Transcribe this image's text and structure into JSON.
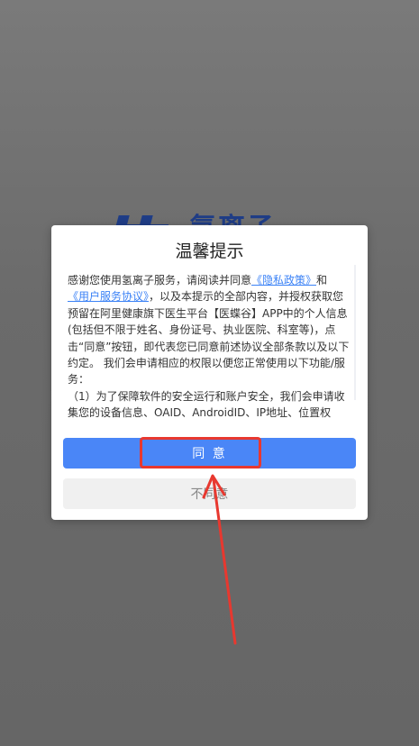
{
  "brand": {
    "logo_text": "氢离子"
  },
  "dialog": {
    "title": "温馨提示",
    "text_intro": "感谢您使用氢离子服务，请阅读并同意",
    "privacy_link": "《隐私政策》",
    "and_text": "和",
    "agreement_link": "《用户服务协议》",
    "text_body": "，以及本提示的全部内容，并授权获取您预留在阿里健康旗下医生平台【医蝶谷】APP中的个人信息(包括但不限于姓名、身份证号、执业医院、科室等)，点击“同意”按钮，即代表您已同意前述协议全部条款以及以下约定。 我们会申请相应的权限以便您正常使用以下功能/服务：",
    "text_item1": "（1）为了保障软件的安全运行和账户安全，我们会申请收集您的设备信息、OAID、AndroidID、IP地址、位置权",
    "agree_label": "同 意",
    "disagree_label": "不同意"
  },
  "annotation": {
    "highlight_color": "#e8382f"
  },
  "colors": {
    "primary": "#4a86f7",
    "link": "#3b82f6"
  }
}
